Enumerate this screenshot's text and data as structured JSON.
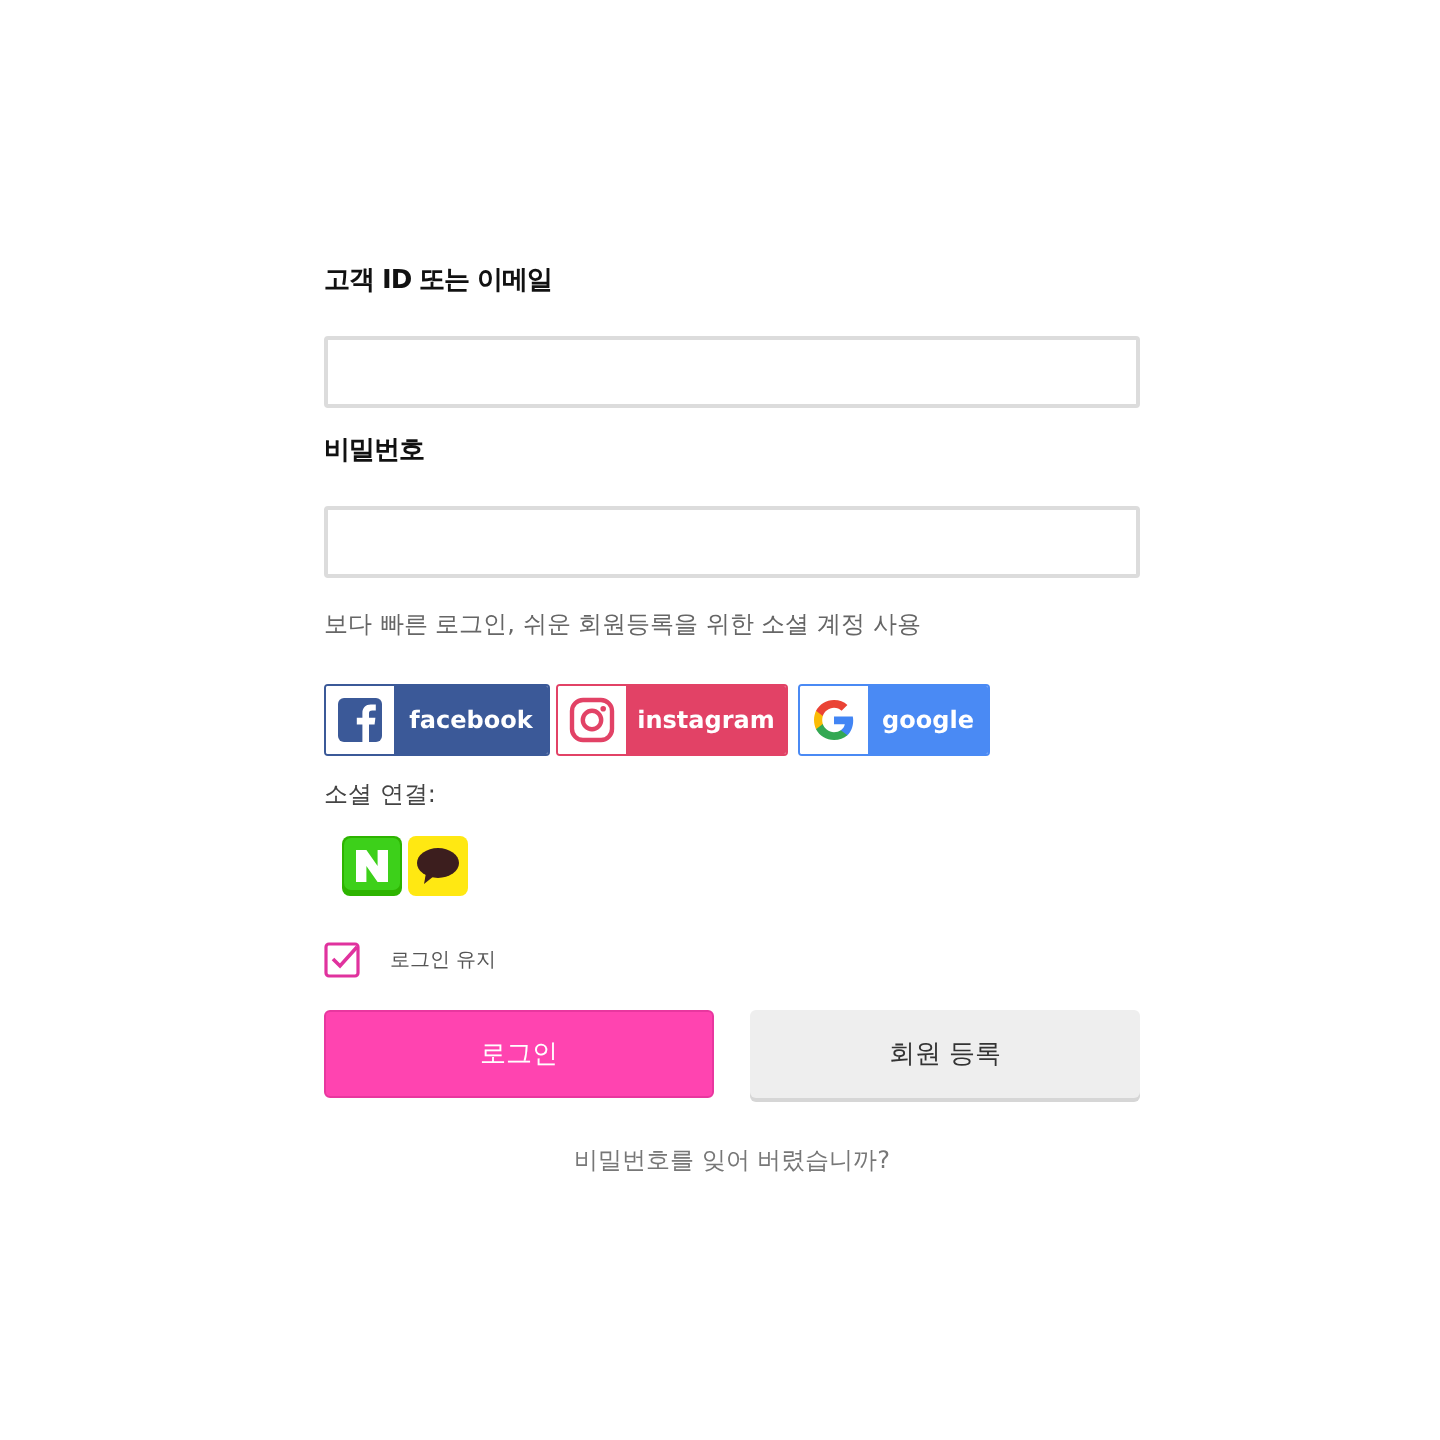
{
  "fields": [
    {
      "label": "고객 ID 또는 이메일"
    },
    {
      "label": "비밀번호"
    }
  ],
  "social_hint": "보다 빠른 로그인, 쉬운 회원등록을 위한 소셜 계정 사용",
  "social_buttons": [
    {
      "kind": "facebook",
      "label": "facebook",
      "color": "#3b5998"
    },
    {
      "kind": "instagram",
      "label": "instagram",
      "color": "#e24266"
    },
    {
      "kind": "google",
      "label": "google",
      "color": "#4a8af4"
    }
  ],
  "social_connect": {
    "label": "소셜 연결:",
    "services": [
      {
        "kind": "naver"
      },
      {
        "kind": "kakao"
      }
    ]
  },
  "remember": {
    "label": "로그인 유지",
    "checked": true
  },
  "buttons": [
    {
      "kind": "primary",
      "label": "로그인"
    },
    {
      "kind": "secondary",
      "label": "회원 등록"
    }
  ],
  "forgot_link": "비밀번호를 잊어 버렸습니까?"
}
